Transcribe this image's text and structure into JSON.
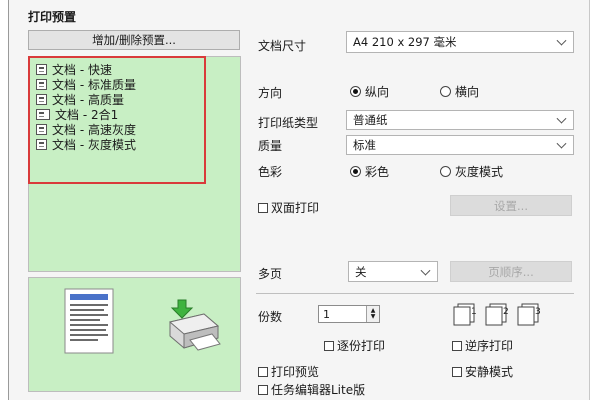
{
  "preset": {
    "title": "打印预置",
    "add_delete_label": "增加/删除预置...",
    "items": [
      {
        "icon": "single-page-icon",
        "label": "文档 - 快速"
      },
      {
        "icon": "single-page-icon",
        "label": "文档 - 标准质量"
      },
      {
        "icon": "single-page-icon",
        "label": "文档 - 高质量"
      },
      {
        "icon": "two-up-icon",
        "label": "文档 - 2合1"
      },
      {
        "icon": "single-page-icon",
        "label": "文档 - 高速灰度"
      },
      {
        "icon": "single-page-icon",
        "label": "文档 - 灰度模式"
      }
    ]
  },
  "settings": {
    "doc_size_label": "文档尺寸",
    "doc_size_value": "A4 210 x 297 毫米",
    "orientation_label": "方向",
    "portrait_label": "纵向",
    "landscape_label": "横向",
    "orientation_selected": "portrait",
    "paper_type_label": "打印纸类型",
    "paper_type_value": "普通纸",
    "quality_label": "质量",
    "quality_value": "标准",
    "color_label": "色彩",
    "color_option": "彩色",
    "grayscale_option": "灰度模式",
    "color_selected": "color",
    "duplex_label": "双面打印",
    "duplex_settings_label": "设置...",
    "multipage_label": "多页",
    "multipage_value": "关",
    "page_order_label": "页顺序...",
    "copies_label": "份数",
    "copies_value": "1",
    "collate_label": "逐份打印",
    "reverse_label": "逆序打印",
    "print_preview_label": "打印预览",
    "quiet_mode_label": "安静模式",
    "job_arranger_label": "任务编辑器Lite版"
  },
  "colors": {
    "preview_bg": "#c8efc4",
    "highlight_border": "#d93a3a",
    "dialog_bg": "#f5f5f5"
  }
}
